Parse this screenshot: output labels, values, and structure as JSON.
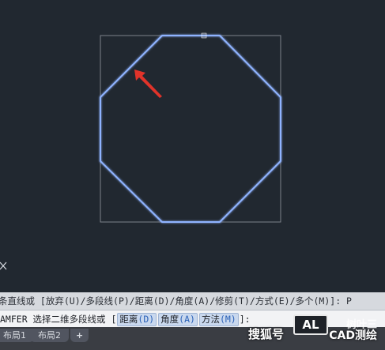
{
  "command": {
    "history_text": "条直线或 [放弃(U)/多段线(P)/距离(D)/角度(A)/修剪(T)/方式(E)/多个(M)]: P",
    "prompt_prefix": "AMFER 选择二维多段线或 [",
    "options": [
      {
        "label": "距离",
        "key": "(D)"
      },
      {
        "label": "角度",
        "key": "(A)"
      },
      {
        "label": "方法",
        "key": "(M)"
      }
    ],
    "prompt_suffix": "]:"
  },
  "tabs": [
    "布局1",
    "布局2"
  ],
  "add_tab_symbol": "+",
  "watermark": {
    "brand": "搜狐号",
    "logo": "AL",
    "side_text": "树叶三",
    "caption": "CAD测绘"
  },
  "colors": {
    "canvas_bg": "#212830",
    "octagon_stroke": "#8fb3ff",
    "bbox_stroke": "#7d828a",
    "arrow": "#e0332a"
  },
  "icons": {
    "close": "close-icon",
    "grip": "grip-square-icon",
    "arrow": "red-arrow-annotation"
  }
}
